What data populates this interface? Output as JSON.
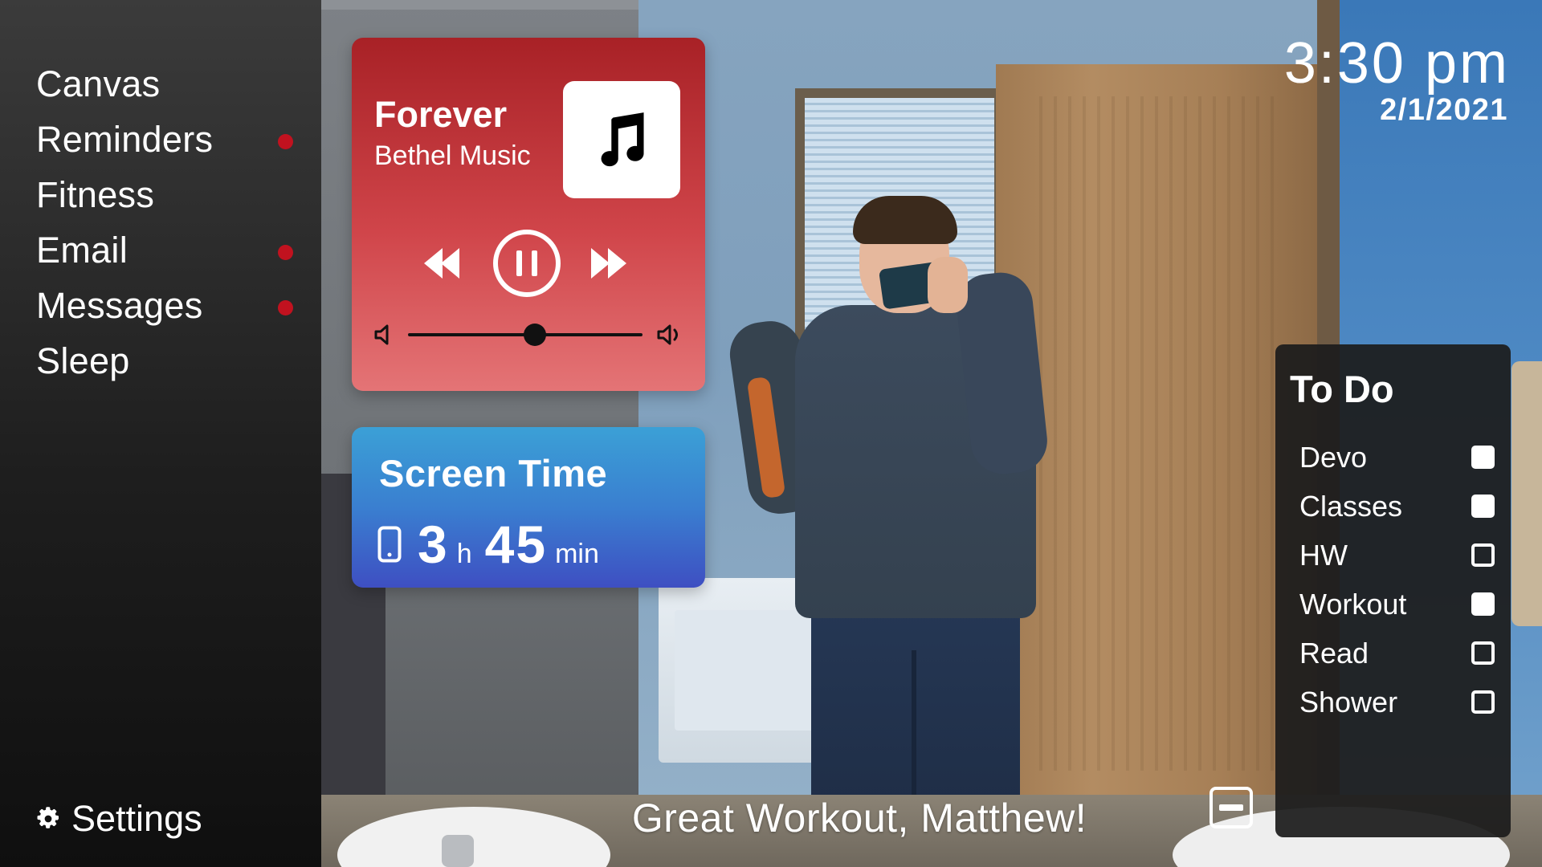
{
  "sidebar": {
    "items": [
      {
        "label": "Canvas",
        "notification": false
      },
      {
        "label": "Reminders",
        "notification": true
      },
      {
        "label": "Fitness",
        "notification": false
      },
      {
        "label": "Email",
        "notification": true
      },
      {
        "label": "Messages",
        "notification": true
      },
      {
        "label": "Sleep",
        "notification": false
      }
    ],
    "settings_label": "Settings",
    "settings_icon": "gear-icon"
  },
  "music": {
    "title": "Forever",
    "artist": "Bethel Music",
    "album_art_icon": "music-note-icon",
    "state": "playing",
    "volume": 0.54,
    "accent": "#c1121f"
  },
  "screen_time": {
    "title": "Screen Time",
    "hours": "3",
    "hours_unit": "h",
    "minutes": "45",
    "minutes_unit": "min",
    "icon": "phone-icon"
  },
  "clock": {
    "time": "3:30 pm",
    "date": "2/1/2021"
  },
  "todo": {
    "title": "To Do",
    "items": [
      {
        "label": "Devo",
        "checked": true
      },
      {
        "label": "Classes",
        "checked": true
      },
      {
        "label": "HW",
        "checked": false
      },
      {
        "label": "Workout",
        "checked": true
      },
      {
        "label": "Read",
        "checked": false
      },
      {
        "label": "Shower",
        "checked": false
      }
    ]
  },
  "message": "Great Workout, Matthew!",
  "colors": {
    "notification_dot": "#c1121f",
    "music_card_top": "#a82126",
    "screen_time_bottom": "#3e4fc2"
  }
}
